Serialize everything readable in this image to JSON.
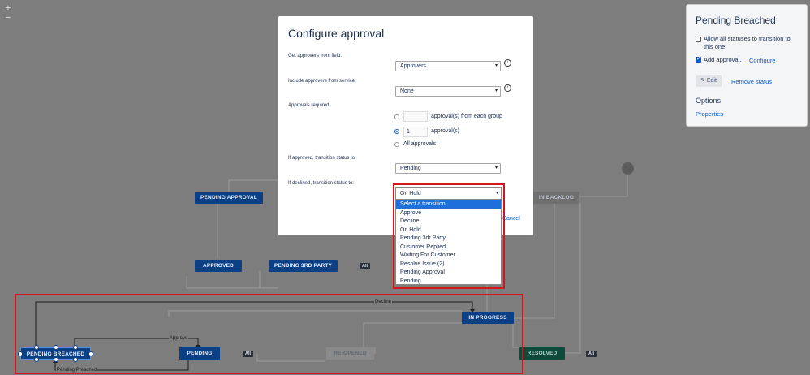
{
  "zoom": {
    "plus": "+",
    "minus": "−"
  },
  "workflow": {
    "nodes": {
      "pending_approval": "PENDING APPROVAL",
      "in_backlog": "IN BACKLOG",
      "approved": "APPROVED",
      "pending_3rd_party": "PENDING 3RD PARTY",
      "in_progress": "IN PROGRESS",
      "pending_breached": "PENDING BREACHED",
      "pending": "PENDING",
      "re_opened": "RE-OPENED",
      "resolved": "RESOLVED"
    },
    "badges": {
      "all": "All"
    },
    "edges": {
      "decline": "Decline",
      "approve": "Approve",
      "pending_preached": "Pending Preached"
    },
    "colors": {
      "node_blue": "#0b3f86",
      "node_green": "#0d4a39",
      "highlight_red": "#d4161c"
    }
  },
  "side_panel": {
    "title": "Pending Breached",
    "allow_all_label": "Allow all statuses to transition to this one",
    "allow_all_checked": false,
    "add_approval_label": "Add approval.",
    "add_approval_checked": true,
    "configure_link": "Configure",
    "edit_button": "Edit",
    "remove_status": "Remove status",
    "options_heading": "Options",
    "properties_link": "Properties"
  },
  "modal": {
    "title": "Configure approval",
    "approvers_field_label": "Get approvers from field:",
    "approvers_field_value": "Approvers",
    "service_label": "Include approvers from service:",
    "service_value": "None",
    "approvals_required_label": "Approvals required:",
    "each_group_value": "",
    "each_group_label": "approval(s) from each group",
    "count_value": "1",
    "count_label": "approval(s)",
    "all_approvals_label": "All approvals",
    "approved_status_label": "If approved, transition status to:",
    "approved_status_value": "Pending",
    "declined_status_label": "If declined, transition status to:",
    "declined_status_value": "On Hold",
    "cancel": "Cancel",
    "info_icon": "i",
    "declined_options": [
      "Select a transition",
      "Approve",
      "Decline",
      "On Hold",
      "Pending 3dr Party",
      "Customer Replied",
      "Waiting For Customer",
      "Resolve Issue (2)",
      "Pending Approval",
      "Pending"
    ],
    "highlighted_option": "Select a transition"
  }
}
